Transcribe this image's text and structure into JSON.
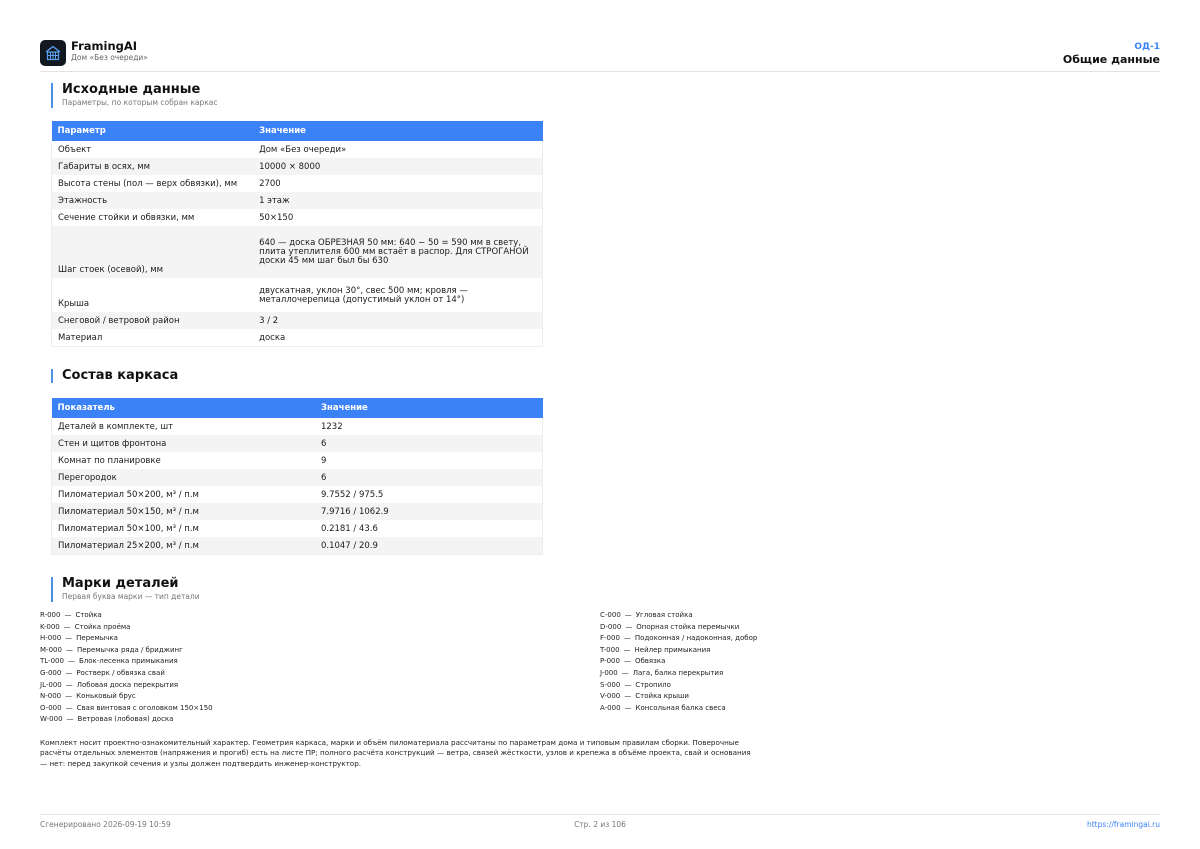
{
  "header": {
    "brand_title": "FramingAI",
    "brand_sub": "Дом «Без очереди»",
    "sheet_code": "ОД-1",
    "sheet_title": "Общие данные"
  },
  "source": {
    "title": "Исходные данные",
    "subtitle": "Параметры, по которым собран каркас",
    "columns": [
      "Параметр",
      "Значение"
    ],
    "rows": [
      {
        "p": "Объект",
        "v": "Дом «Без очереди»"
      },
      {
        "p": "Габариты в осях, мм",
        "v": "10000 × 8000"
      },
      {
        "p": "Высота стены (пол — верх обвязки), мм",
        "v": "2700"
      },
      {
        "p": "Этажность",
        "v": "1 этаж"
      },
      {
        "p": "Сечение стойки и обвязки, мм",
        "v": "50×150"
      },
      {
        "p": "Шаг стоек (осевой), мм",
        "v": "640 — доска ОБРЕЗНАЯ 50 мм: 640 − 50 = 590 мм в свету, плита утеплителя 600 мм встаёт в распор. Для СТРОГАНОЙ доски 45 мм шаг был бы 630"
      },
      {
        "p": "Крыша",
        "v": "двускатная, уклон 30°, свес 500 мм; кровля — металлочерепица (допустимый уклон от 14°)"
      },
      {
        "p": "Снеговой / ветровой район",
        "v": "3 / 2"
      },
      {
        "p": "Материал",
        "v": "доска"
      }
    ]
  },
  "composition": {
    "title": "Состав каркаса",
    "columns": [
      "Показатель",
      "Значение"
    ],
    "rows": [
      {
        "p": "Деталей в комплекте, шт",
        "v": "1232"
      },
      {
        "p": "Стен и щитов фронтона",
        "v": "6"
      },
      {
        "p": "Комнат по планировке",
        "v": "9"
      },
      {
        "p": "Перегородок",
        "v": "6"
      },
      {
        "p": "Пиломатериал 50×200, м³ / п.м",
        "v": "9.7552 / 975.5"
      },
      {
        "p": "Пиломатериал 50×150, м³ / п.м",
        "v": "7.9716 / 1062.9"
      },
      {
        "p": "Пиломатериал 50×100, м³ / п.м",
        "v": "0.2181 / 43.6"
      },
      {
        "p": "Пиломатериал 25×200, м³ / п.м",
        "v": "0.1047 / 20.9"
      }
    ]
  },
  "marks": {
    "title": "Марки деталей",
    "subtitle": "Первая буква марки — тип детали",
    "separator": "—",
    "left": [
      {
        "code": "R-000",
        "name": "Стойка"
      },
      {
        "code": "K-000",
        "name": "Стойка проёма"
      },
      {
        "code": "H-000",
        "name": "Перемычка"
      },
      {
        "code": "M-000",
        "name": "Перемычка ряда / бриджинг"
      },
      {
        "code": "TL-000",
        "name": "Блок-лесенка примыкания"
      },
      {
        "code": "G-000",
        "name": "Ростверк / обвязка свай"
      },
      {
        "code": "JL-000",
        "name": "Лобовая доска перекрытия"
      },
      {
        "code": "N-000",
        "name": "Коньковый брус"
      },
      {
        "code": "O-000",
        "name": "Свая винтовая с оголовком 150×150"
      },
      {
        "code": "W-000",
        "name": "Ветровая (лобовая) доска"
      }
    ],
    "right": [
      {
        "code": "C-000",
        "name": "Угловая стойка"
      },
      {
        "code": "D-000",
        "name": "Опорная стойка перемычки"
      },
      {
        "code": "F-000",
        "name": "Подоконная / надоконная, добор"
      },
      {
        "code": "T-000",
        "name": "Нейлер примыкания"
      },
      {
        "code": "P-000",
        "name": "Обвязка"
      },
      {
        "code": "J-000",
        "name": "Лага, балка перекрытия"
      },
      {
        "code": "S-000",
        "name": "Стропило"
      },
      {
        "code": "V-000",
        "name": "Стойка крыши"
      },
      {
        "code": "A-000",
        "name": "Консольная балка свеса"
      }
    ]
  },
  "note": "Комплект носит проектно-ознакомительный характер. Геометрия каркаса, марки и объём пиломатериала рассчитаны по параметрам дома и типовым правилам сборки. Поверочные расчёты отдельных элементов (напряжения и прогиб) есть на листе ПР; полного расчёта конструкций — ветра, связей жёсткости, узлов и крепежа в объёме проекта, свай и основания — нет: перед закупкой сечения и узлы должен подтвердить инженер-конструктор.",
  "footer": {
    "generated": "Сгенерировано 2026-09-19 10:59",
    "page": "Стр. 2 из 106",
    "link": "https://framingai.ru"
  }
}
